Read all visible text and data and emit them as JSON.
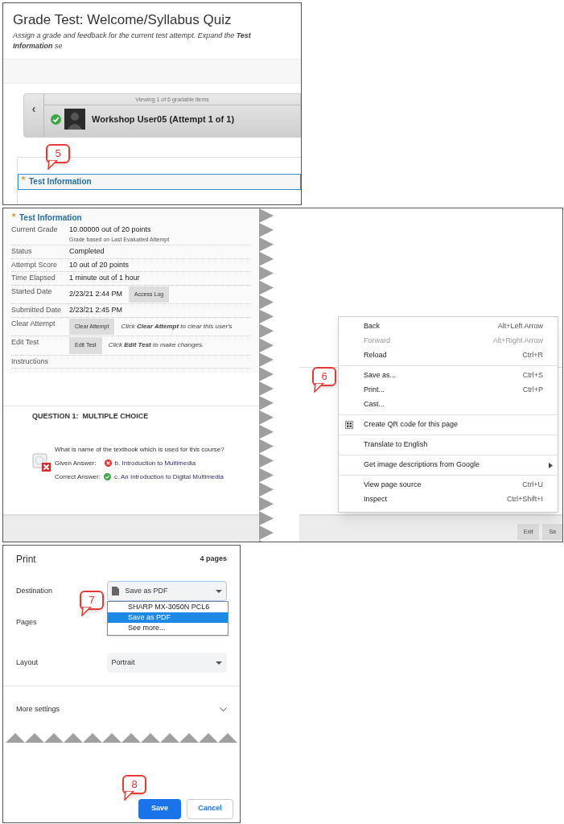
{
  "grade_page": {
    "title": "Grade Test: Welcome/Syllabus Quiz",
    "subtitle": "Assign a grade and feedback for the current test attempt. Expand the **Test Information** se",
    "viewing": "Viewing 1 of 6 gradable items",
    "prev": "‹",
    "student": "Workshop User05 (Attempt 1 of 1)",
    "section_title": "Test Information",
    "callout": "5"
  },
  "test_info": {
    "section_title": "Test Information",
    "rows": [
      {
        "label": "Current Grade",
        "value": "10.00000 out of 20 points",
        "note": "Grade based on Last Evaluated Attempt"
      },
      {
        "label": "Status",
        "value": "Completed"
      },
      {
        "label": "Attempt Score",
        "value": "10 out of 20 points"
      },
      {
        "label": "Time Elapsed",
        "value": "1 minute out of 1 hour"
      },
      {
        "label": "Started Date",
        "value": "2/23/21 2:44 PM",
        "button": "Access Log"
      },
      {
        "label": "Submitted Date",
        "value": "2/23/21 2:45 PM"
      },
      {
        "label": "Clear Attempt",
        "button": "Clear Attempt",
        "hint": "Click **Clear Attempt** to clear this user's"
      },
      {
        "label": "Edit Test",
        "button": "Edit Test",
        "hint": "Click **Edit Test** to make changes."
      },
      {
        "label": "Instructions"
      }
    ],
    "question": {
      "heading": "QUESTION 1:  MULTIPLE CHOICE",
      "text": "What is name of the textbook which is used for this course?",
      "given_label": "Given Answer:",
      "given_answer": "b.  Introduction to Multimedia",
      "correct_label": "Correct Answer:",
      "correct_answer": "c.  An Introduction to Digital Multimedia"
    },
    "footer_buttons": [
      "Exit",
      "Sa"
    ],
    "context_menu": {
      "groups": [
        [
          {
            "label": "Back",
            "shortcut": "Alt+Left Arrow",
            "disabled": false,
            "kind": "plain"
          },
          {
            "label": "Forward",
            "shortcut": "Alt+Right Arrow",
            "disabled": true,
            "kind": "plain"
          },
          {
            "label": "Reload",
            "shortcut": "Ctrl+R",
            "disabled": false,
            "kind": "plain"
          }
        ],
        [
          {
            "label": "Save as...",
            "shortcut": "Ctrl+S",
            "disabled": false,
            "kind": "plain"
          },
          {
            "label": "Print...",
            "shortcut": "Ctrl+P",
            "disabled": false,
            "kind": "plain"
          },
          {
            "label": "Cast...",
            "disabled": false,
            "kind": "plain"
          }
        ],
        [
          {
            "label": "Create QR code for this page",
            "disabled": false,
            "kind": "qr"
          }
        ],
        [
          {
            "label": "Translate to English",
            "disabled": false,
            "kind": "plain"
          }
        ],
        [
          {
            "label": "Get image descriptions from Google",
            "disabled": false,
            "kind": "submenu"
          }
        ],
        [
          {
            "label": "View page source",
            "shortcut": "Ctrl+U",
            "disabled": false,
            "kind": "plain"
          },
          {
            "label": "Inspect",
            "shortcut": "Ctrl+Shift+I",
            "disabled": false,
            "kind": "plain"
          }
        ]
      ]
    },
    "callout": "6"
  },
  "print_dialog": {
    "title": "Print",
    "pages_count": "4 pages",
    "destination_label": "Destination",
    "destination": "Save as PDF",
    "options": [
      {
        "label": "SHARP MX-3050N PCL6",
        "selected": false
      },
      {
        "label": "Save as PDF",
        "selected": true
      },
      {
        "label": "See more...",
        "selected": false
      }
    ],
    "pages_label": "Pages",
    "layout_label": "Layout",
    "layout": "Portrait",
    "more_settings": "More settings",
    "save": "Save",
    "cancel": "Cancel",
    "callouts": [
      "7",
      "8"
    ]
  }
}
